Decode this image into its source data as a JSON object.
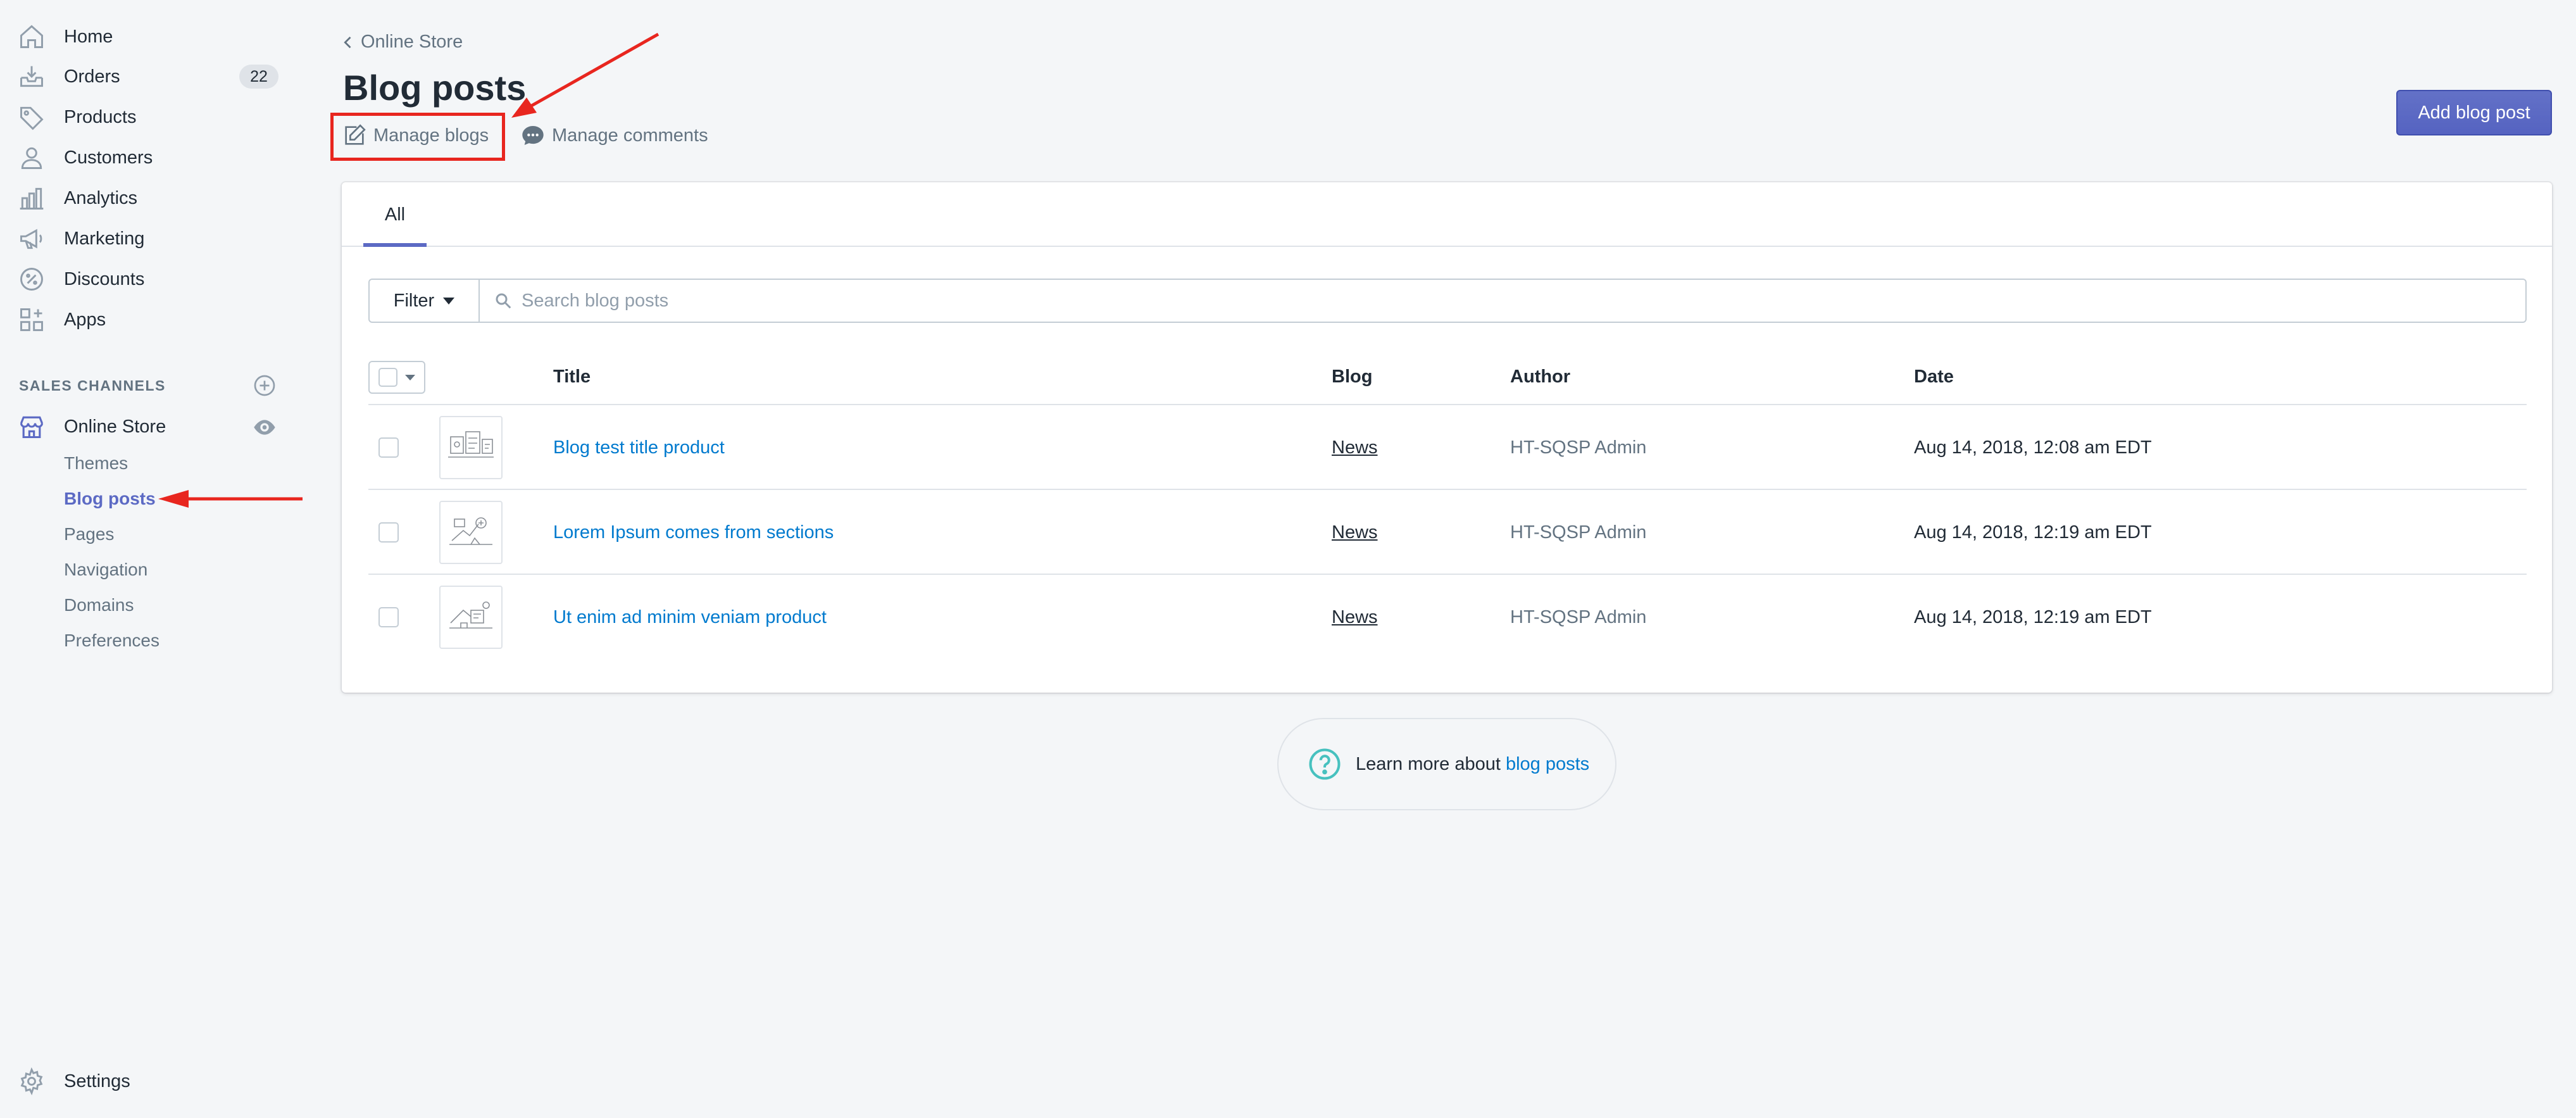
{
  "sidebar": {
    "items": [
      {
        "label": "Home",
        "icon": "home-icon"
      },
      {
        "label": "Orders",
        "icon": "orders-icon",
        "badge": "22"
      },
      {
        "label": "Products",
        "icon": "tag-icon"
      },
      {
        "label": "Customers",
        "icon": "person-icon"
      },
      {
        "label": "Analytics",
        "icon": "bar-chart-icon"
      },
      {
        "label": "Marketing",
        "icon": "megaphone-icon"
      },
      {
        "label": "Discounts",
        "icon": "discount-icon"
      },
      {
        "label": "Apps",
        "icon": "apps-icon"
      }
    ],
    "sales_channels_heading": "SALES CHANNELS",
    "online_store": {
      "label": "Online Store",
      "icon": "store-icon"
    },
    "sub_items": [
      "Themes",
      "Blog posts",
      "Pages",
      "Navigation",
      "Domains",
      "Preferences"
    ],
    "active_sub_item": "Blog posts",
    "settings_label": "Settings"
  },
  "header": {
    "breadcrumb": "Online Store",
    "title": "Blog posts",
    "manage_blogs_label": "Manage blogs",
    "manage_comments_label": "Manage comments",
    "add_button_label": "Add blog post"
  },
  "tabs": [
    {
      "label": "All",
      "selected": true
    }
  ],
  "filter": {
    "button_label": "Filter",
    "search_placeholder": "Search blog posts"
  },
  "table": {
    "columns": [
      "Title",
      "Blog",
      "Author",
      "Date"
    ],
    "rows": [
      {
        "title": "Blog test title product",
        "blog": "News",
        "author": "HT-SQSP Admin",
        "date": "Aug 14, 2018, 12:08 am EDT"
      },
      {
        "title": "Lorem Ipsum comes from sections",
        "blog": "News",
        "author": "HT-SQSP Admin",
        "date": "Aug 14, 2018, 12:19 am EDT"
      },
      {
        "title": "Ut enim ad minim veniam product",
        "blog": "News",
        "author": "HT-SQSP Admin",
        "date": "Aug 14, 2018, 12:19 am EDT"
      }
    ]
  },
  "help": {
    "text": "Learn more about",
    "link": "blog posts"
  },
  "colors": {
    "accent": "#5c6ac4",
    "link": "#007ace",
    "annotation": "#e8261f",
    "help_icon": "#47c1bf"
  }
}
